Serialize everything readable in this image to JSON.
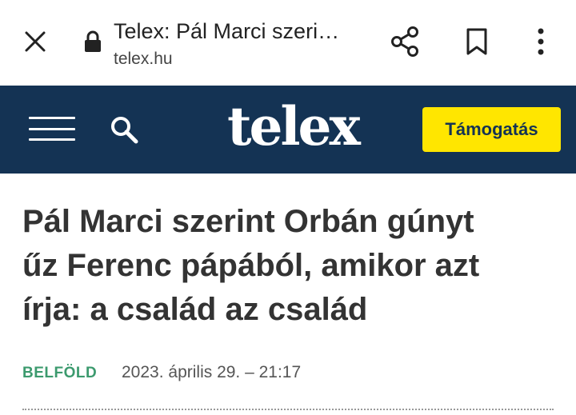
{
  "browser": {
    "tab_title": "Telex: Pál Marci szeri…",
    "domain": "telex.hu",
    "icons": [
      "close-icon",
      "lock-icon",
      "share-icon",
      "bookmark-icon",
      "more-vert-icon"
    ]
  },
  "site_header": {
    "logo": "telex",
    "support_label": "Támogatás",
    "colors": {
      "header_bg": "#143354",
      "support_bg": "#ffe600"
    },
    "icons": [
      "menu-icon",
      "search-icon"
    ]
  },
  "article": {
    "headline_lines": [
      "Pál Marci szerint Orbán gúnyt",
      "űz Ferenc pápából, amikor azt",
      "írja: a család az család"
    ],
    "category": "BELFÖLD",
    "date": "2023. április 29. – 21:17",
    "colors": {
      "category": "#3c9a6e"
    }
  }
}
